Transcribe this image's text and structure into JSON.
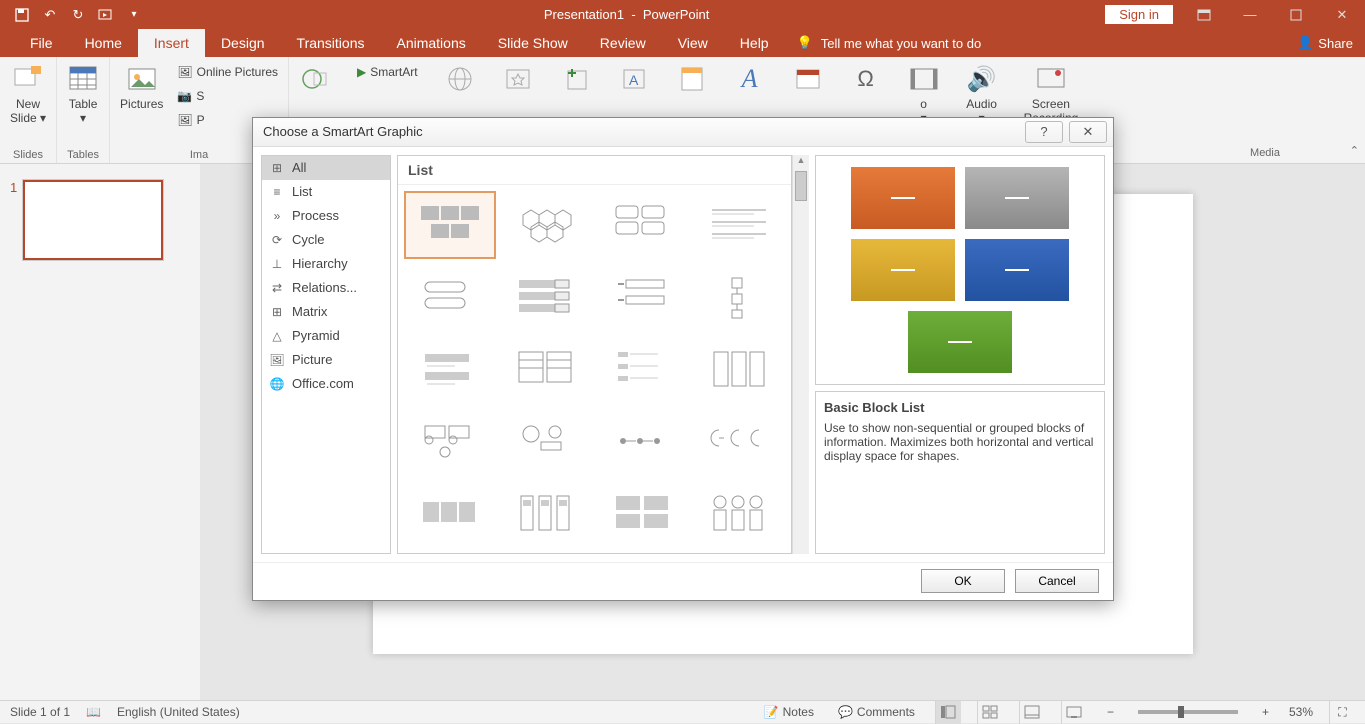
{
  "titlebar": {
    "doc_name": "Presentation1",
    "app_name": "PowerPoint",
    "signin": "Sign in"
  },
  "ribbon_tabs": [
    "File",
    "Home",
    "Insert",
    "Design",
    "Transitions",
    "Animations",
    "Slide Show",
    "Review",
    "View",
    "Help"
  ],
  "active_tab": "Insert",
  "tellme": "Tell me what you want to do",
  "share": "Share",
  "ribbon": {
    "slides": {
      "new_slide": "New\nSlide",
      "label": "Slides"
    },
    "tables": {
      "table": "Table",
      "label": "Tables"
    },
    "images": {
      "pictures": "Pictures",
      "online_pictures": "Online Pictures",
      "screenshot": "S",
      "photo_album": "P",
      "label": "Ima"
    },
    "illustrations": {
      "smartart": "SmartArt"
    },
    "media": {
      "audio": "Audio",
      "screen_recording": "Screen\nRecording",
      "label": "Media"
    }
  },
  "dialog": {
    "title": "Choose a SmartArt Graphic",
    "categories": [
      "All",
      "List",
      "Process",
      "Cycle",
      "Hierarchy",
      "Relations...",
      "Matrix",
      "Pyramid",
      "Picture",
      "Office.com"
    ],
    "selected_category": "All",
    "middle_header": "List",
    "preview_title": "Basic Block List",
    "preview_desc": "Use to show non-sequential or grouped blocks of information. Maximizes both horizontal and vertical display space for shapes.",
    "ok": "OK",
    "cancel": "Cancel",
    "preview_colors": [
      "#D96B2E",
      "#9E9E9E",
      "#D9A82E",
      "#2E62B0",
      "#5E9E2E"
    ]
  },
  "statusbar": {
    "slide_info": "Slide 1 of 1",
    "language": "English (United States)",
    "notes": "Notes",
    "comments": "Comments",
    "zoom": "53%"
  },
  "thumb": {
    "num": "1"
  }
}
